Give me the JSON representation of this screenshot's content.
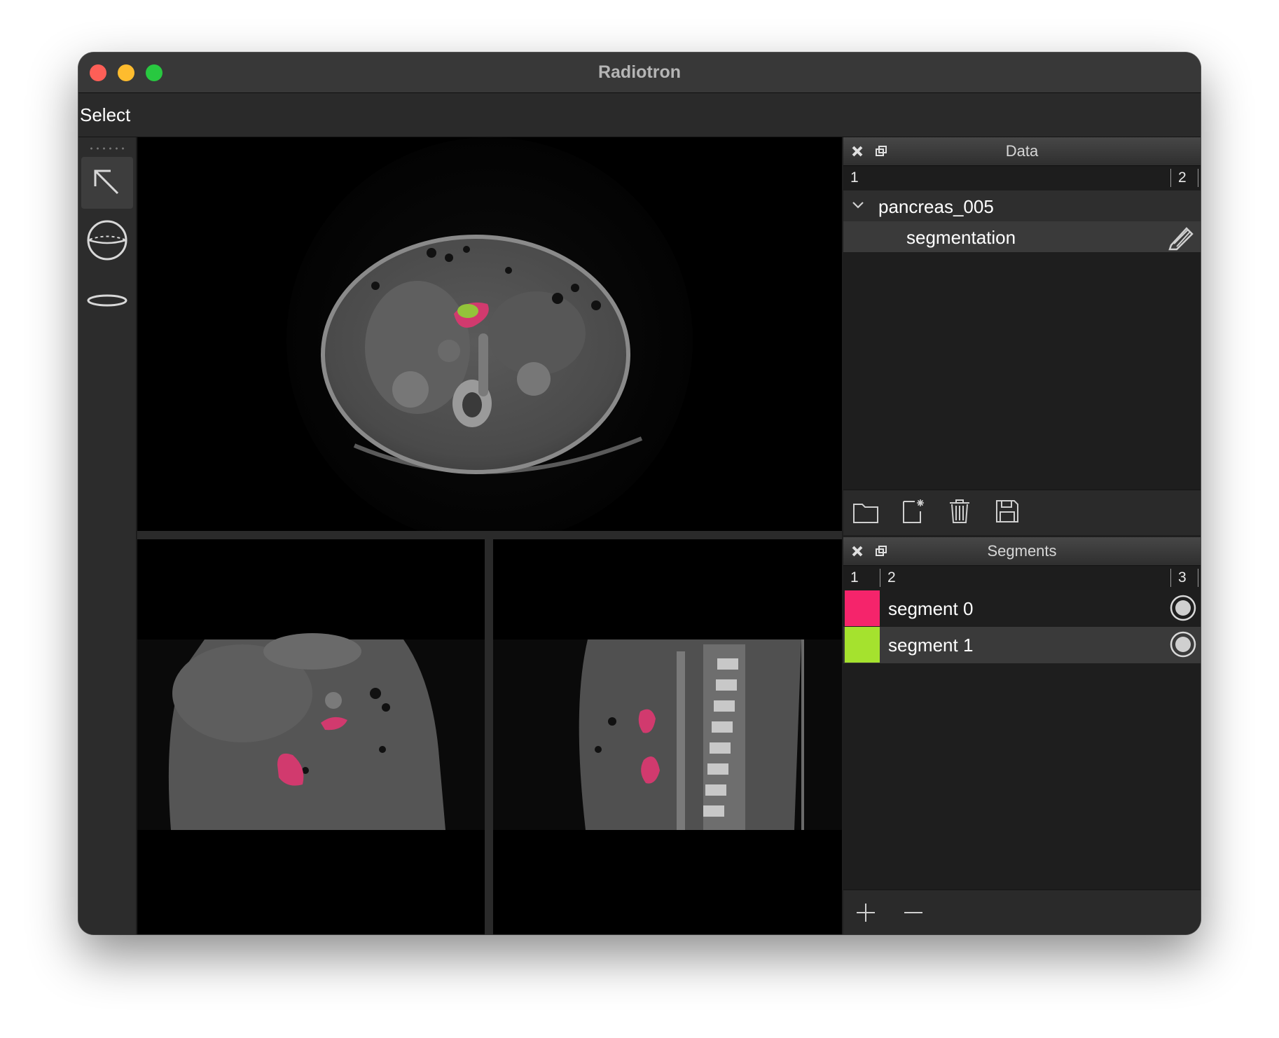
{
  "window": {
    "title": "Radiotron",
    "traffic_lights": {
      "close": "#fe5f57",
      "minimize": "#febc2e",
      "zoom": "#28c840"
    }
  },
  "menubar": {
    "label": "Select"
  },
  "toolbar": {
    "tools": [
      {
        "name": "select",
        "icon": "arrow-pointer-icon",
        "active": true
      },
      {
        "name": "sphere",
        "icon": "sphere-icon",
        "active": false
      },
      {
        "name": "ellipse",
        "icon": "ellipse-icon",
        "active": false
      }
    ]
  },
  "viewports": [
    {
      "name": "axial",
      "description_icon": "ct-axial-slice"
    },
    {
      "name": "coronal",
      "description_icon": "ct-coronal-slice"
    },
    {
      "name": "sagittal",
      "description_icon": "ct-sagittal-slice"
    }
  ],
  "data_panel": {
    "title": "Data",
    "columns": [
      "1",
      "2"
    ],
    "tree": {
      "parent": "pancreas_005",
      "children": [
        {
          "label": "segmentation",
          "action_icon": "pencil-icon"
        }
      ]
    },
    "footer_icons": [
      "folder-icon",
      "new-file-icon",
      "trash-icon",
      "save-icon"
    ]
  },
  "segments_panel": {
    "title": "Segments",
    "columns": [
      "1",
      "2",
      "3"
    ],
    "segments": [
      {
        "label": "segment 0",
        "color": "#f5246b"
      },
      {
        "label": "segment 1",
        "color": "#a5e22e"
      }
    ],
    "footer_icons": [
      "plus-icon",
      "minus-icon"
    ]
  }
}
